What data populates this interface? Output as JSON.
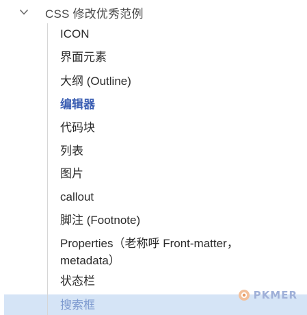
{
  "tree": {
    "parent": {
      "label": "CSS 修改优秀范例",
      "expanded": true
    },
    "children": [
      {
        "label": "ICON"
      },
      {
        "label": "界面元素"
      },
      {
        "label": "大纲 (Outline)"
      },
      {
        "label": "编辑器",
        "state": "active"
      },
      {
        "label": "代码块"
      },
      {
        "label": "列表"
      },
      {
        "label": "图片"
      },
      {
        "label": "callout"
      },
      {
        "label": "脚注 (Footnote)"
      },
      {
        "label": "Properties（老称呼 Front-matter，metadata）"
      },
      {
        "label": "状态栏"
      },
      {
        "label": "搜索框",
        "state": "hovered"
      }
    ]
  },
  "colors": {
    "active_text": "#3c5fb3",
    "hover_background": "#d5e4f6",
    "guide_line": "#d6d6d6"
  },
  "watermark": {
    "text": "PKMER",
    "icon": "pkmer-logo-icon"
  }
}
